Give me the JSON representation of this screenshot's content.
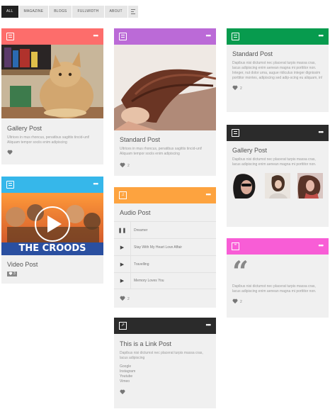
{
  "colors": {
    "red": "#fd6d6b",
    "purple": "#bb6ad7",
    "green": "#079b4e",
    "dark": "#2b2b2b",
    "blue": "#36b7ea",
    "orange": "#fda33f",
    "pink": "#f85dd6"
  },
  "filters": {
    "items": [
      "All",
      "Magazine",
      "Blogs",
      "Fullwidth",
      "About"
    ],
    "menu_icon": "menu-lines-icon"
  },
  "cards": {
    "gallery1": {
      "icon": "image-icon",
      "title": "Gallery Post",
      "excerpt": "Ultrices in mus rhoncus, penatibus sagittis tincid-unt! Aliquam tempor sociis enim adipiscing"
    },
    "standard1": {
      "icon": "document-icon",
      "title": "Standard Post",
      "excerpt": "Ultrices in mus rhoncus, penatibus sagittis tincid-unt! Aliquam tempor sociis enim adipiscing",
      "likes": "2"
    },
    "standard2": {
      "icon": "document-icon",
      "title": "Standard Post",
      "excerpt": "Dapibus nisi dictumst nec placerat turpis massa cras, lacus adipiscing enim aenean magna mi porttitor non.",
      "excerpt2": "Integer, nut dolor urna, augue ridiculus integer dignissim porttitor montes, adipiscing sed adip-scing eu aliquam, in!",
      "likes": "2"
    },
    "gallery2": {
      "icon": "grid-icon",
      "title": "Gallery Post",
      "excerpt": "Dapibus nisi dictumst nec placerat turpis massa cras, lacus adipiscing enim aenean magna mi porttitor non."
    },
    "video": {
      "icon": "play-icon",
      "title": "Video Post",
      "likes": "3",
      "poster_text": "THE CROODS"
    },
    "audio": {
      "icon": "music-icon",
      "title": "Audio Post",
      "tracks": [
        {
          "control": "❚❚",
          "name": "Dreamer"
        },
        {
          "control": "▶",
          "name": "Stay With My Heart Love Affair"
        },
        {
          "control": "▶",
          "name": "Travelling"
        },
        {
          "control": "▶",
          "name": "Memory Loves You"
        }
      ],
      "likes": "2"
    },
    "quote": {
      "icon": "quote-icon",
      "mark": "“",
      "excerpt": "Dapibus nisi dictumst nec placerat turpis massa cras, lacus adipiscing enim aenean magna mi porttitor non.",
      "likes": "2"
    },
    "link": {
      "icon": "link-icon",
      "title": "This is a Link Post",
      "excerpt": "Dapibus nisi dictumst nec placerat turpis massa cras, lacus adipiscing",
      "links": [
        "Google",
        "Instagram",
        "Youtube",
        "Vimeo"
      ]
    }
  }
}
